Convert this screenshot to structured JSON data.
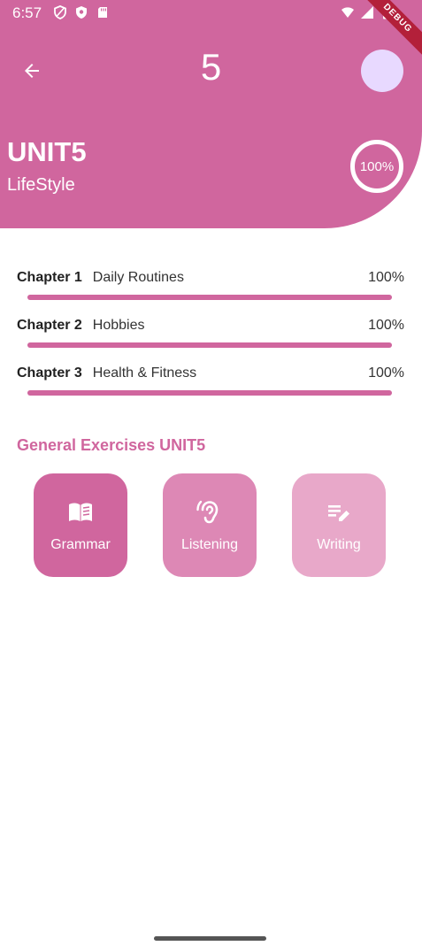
{
  "status_bar": {
    "time": "6:57",
    "debug_label": "DEBUG"
  },
  "header": {
    "title": "5",
    "unit_title": "UNIT5",
    "unit_subtitle": "LifeStyle",
    "unit_progress": "100%",
    "unit_progress_value": 1.0,
    "avatar_color": "#e8d9ff",
    "accent_color": "#d0669e"
  },
  "chapters": [
    {
      "label": "Chapter 1",
      "name": "Daily Routines",
      "percent": "100%",
      "progress": 1.0
    },
    {
      "label": "Chapter 2",
      "name": "Hobbies",
      "percent": "100%",
      "progress": 1.0
    },
    {
      "label": "Chapter 3",
      "name": "Health & Fitness",
      "percent": "100%",
      "progress": 1.0
    }
  ],
  "exercises": {
    "title": "General Exercises UNIT5",
    "items": [
      {
        "label": "Grammar",
        "icon": "book-icon",
        "color": "#d0669e"
      },
      {
        "label": "Listening",
        "icon": "ear-icon",
        "color": "#dd88b5"
      },
      {
        "label": "Writing",
        "icon": "edit-note-icon",
        "color": "#e8a8c9"
      }
    ]
  }
}
